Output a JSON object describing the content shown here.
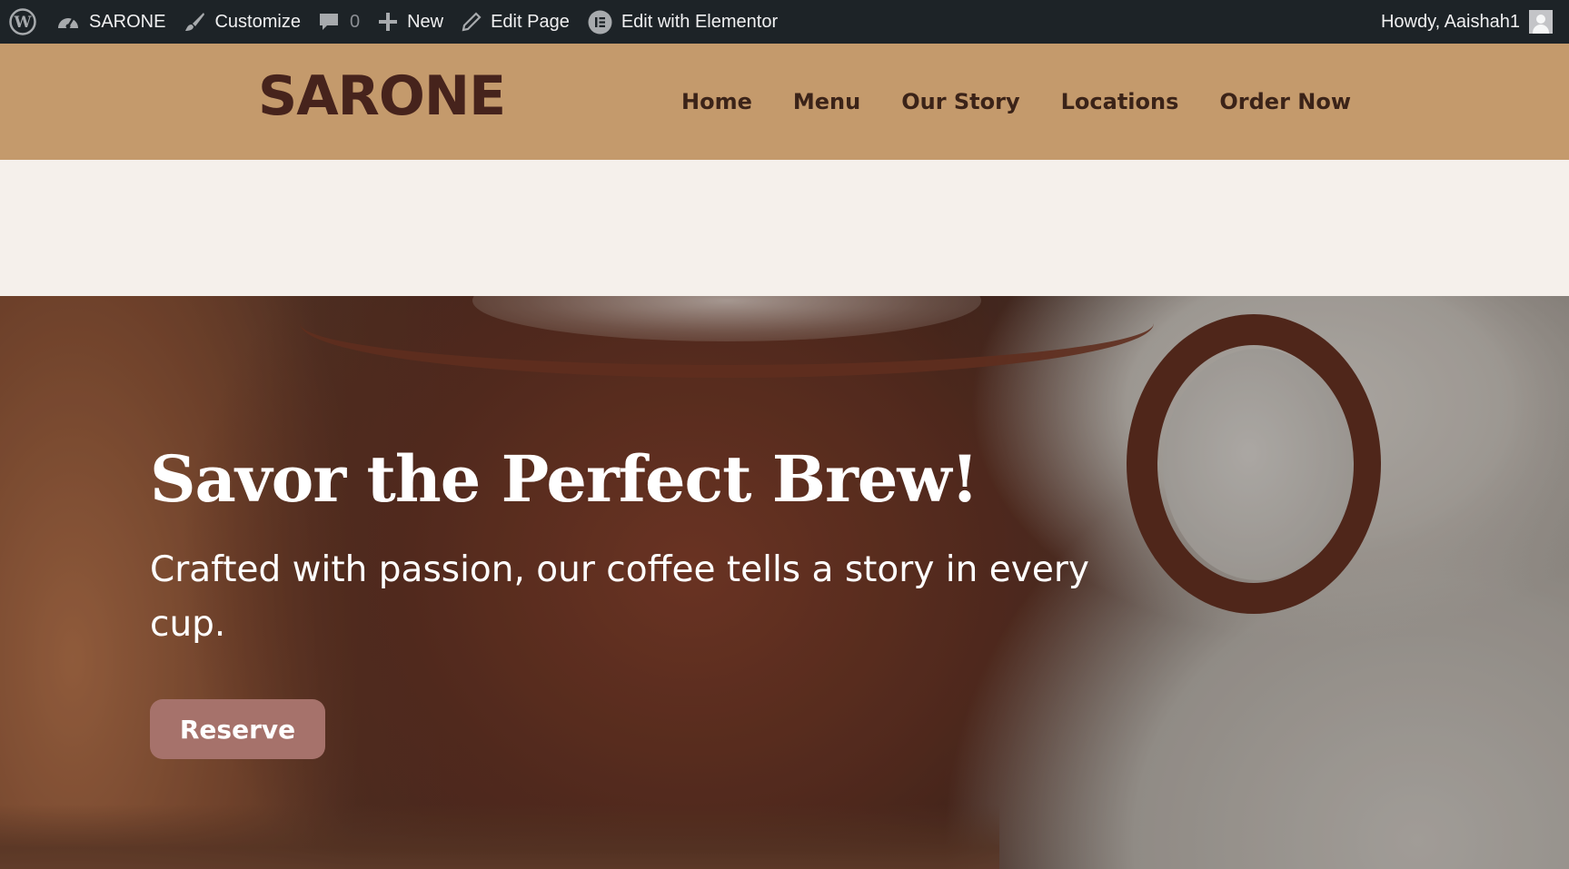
{
  "admin_bar": {
    "site_name": "SARONE",
    "customize": "Customize",
    "comments_count": "0",
    "new": "New",
    "edit_page": "Edit Page",
    "edit_elementor": "Edit with Elementor",
    "howdy": "Howdy, Aaishah1",
    "icons": [
      "wordpress-icon",
      "dashboard-icon",
      "paintbrush-icon",
      "comment-icon",
      "plus-icon",
      "pencil-icon",
      "elementor-icon",
      "avatar"
    ]
  },
  "header": {
    "logo": "SARONE",
    "nav": [
      "Home",
      "Menu",
      "Our Story",
      "Locations",
      "Order Now"
    ]
  },
  "hero": {
    "title": "Savor the Perfect Brew!",
    "subtitle": "Crafted with passion, our coffee tells a story in every cup.",
    "button": "Reserve"
  },
  "colors": {
    "admin_bar": "#1d2327",
    "header_bg": "#c49a6c",
    "logo": "#46231c",
    "nav_text": "#3b2318",
    "page_bg": "#f5f0eb",
    "button": "#a6726b"
  }
}
